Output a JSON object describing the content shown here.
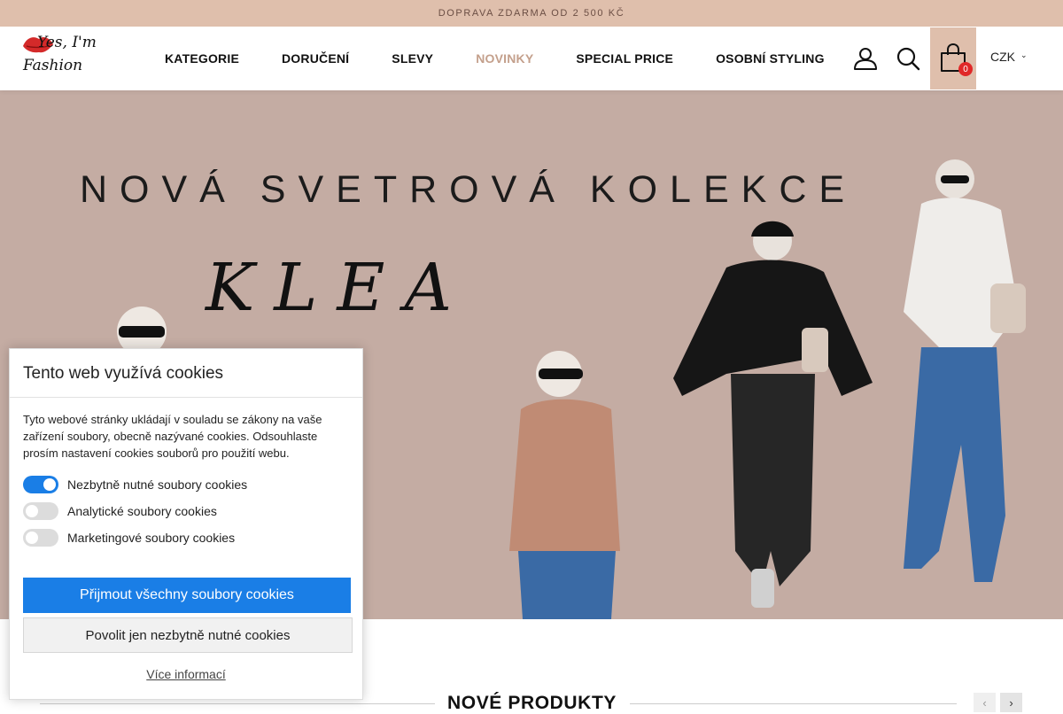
{
  "topbar": {
    "shipping_text": "DOPRAVA ZDARMA OD 2 500 KČ"
  },
  "header": {
    "logo": {
      "line1": "Yes, I'm",
      "line2": "Fashion",
      "accent_color": "#d42a2a"
    },
    "nav": [
      {
        "label": "KATEGORIE",
        "active": false
      },
      {
        "label": "DORUČENÍ",
        "active": false
      },
      {
        "label": "SLEVY",
        "active": false
      },
      {
        "label": "NOVINKY",
        "active": true
      },
      {
        "label": "SPECIAL PRICE",
        "active": false
      },
      {
        "label": "OSOBNÍ STYLING",
        "active": false
      }
    ],
    "icons": {
      "account": "user-icon",
      "search": "search-icon",
      "cart": "shopping-bag-icon"
    },
    "cart_count": "0",
    "currency": "CZK"
  },
  "hero": {
    "title": "NOVÁ SVETROVÁ KOLEKCE",
    "script": "KLEA",
    "background_color": "#c4aca3"
  },
  "section": {
    "title": "NOVÉ PRODUKTY",
    "prev_icon": "chevron-left-icon",
    "next_icon": "chevron-right-icon"
  },
  "cookie_banner": {
    "title": "Tento web využívá cookies",
    "text": "Tyto webové stránky ukládají v souladu se zákony na vaše zařízení soubory, obecně nazývané cookies. Odsouhlaste prosím nastavení cookies souborů pro použití webu.",
    "toggles": [
      {
        "label": "Nezbytně nutné soubory cookies",
        "on": true
      },
      {
        "label": "Analytické soubory cookies",
        "on": false
      },
      {
        "label": "Marketingové soubory cookies",
        "on": false
      }
    ],
    "accept_all_label": "Přijmout všechny soubory cookies",
    "necessary_only_label": "Povolit jen nezbytně nutné cookies",
    "more_info_label": "Více informací",
    "accent_color": "#1a7ee6"
  }
}
